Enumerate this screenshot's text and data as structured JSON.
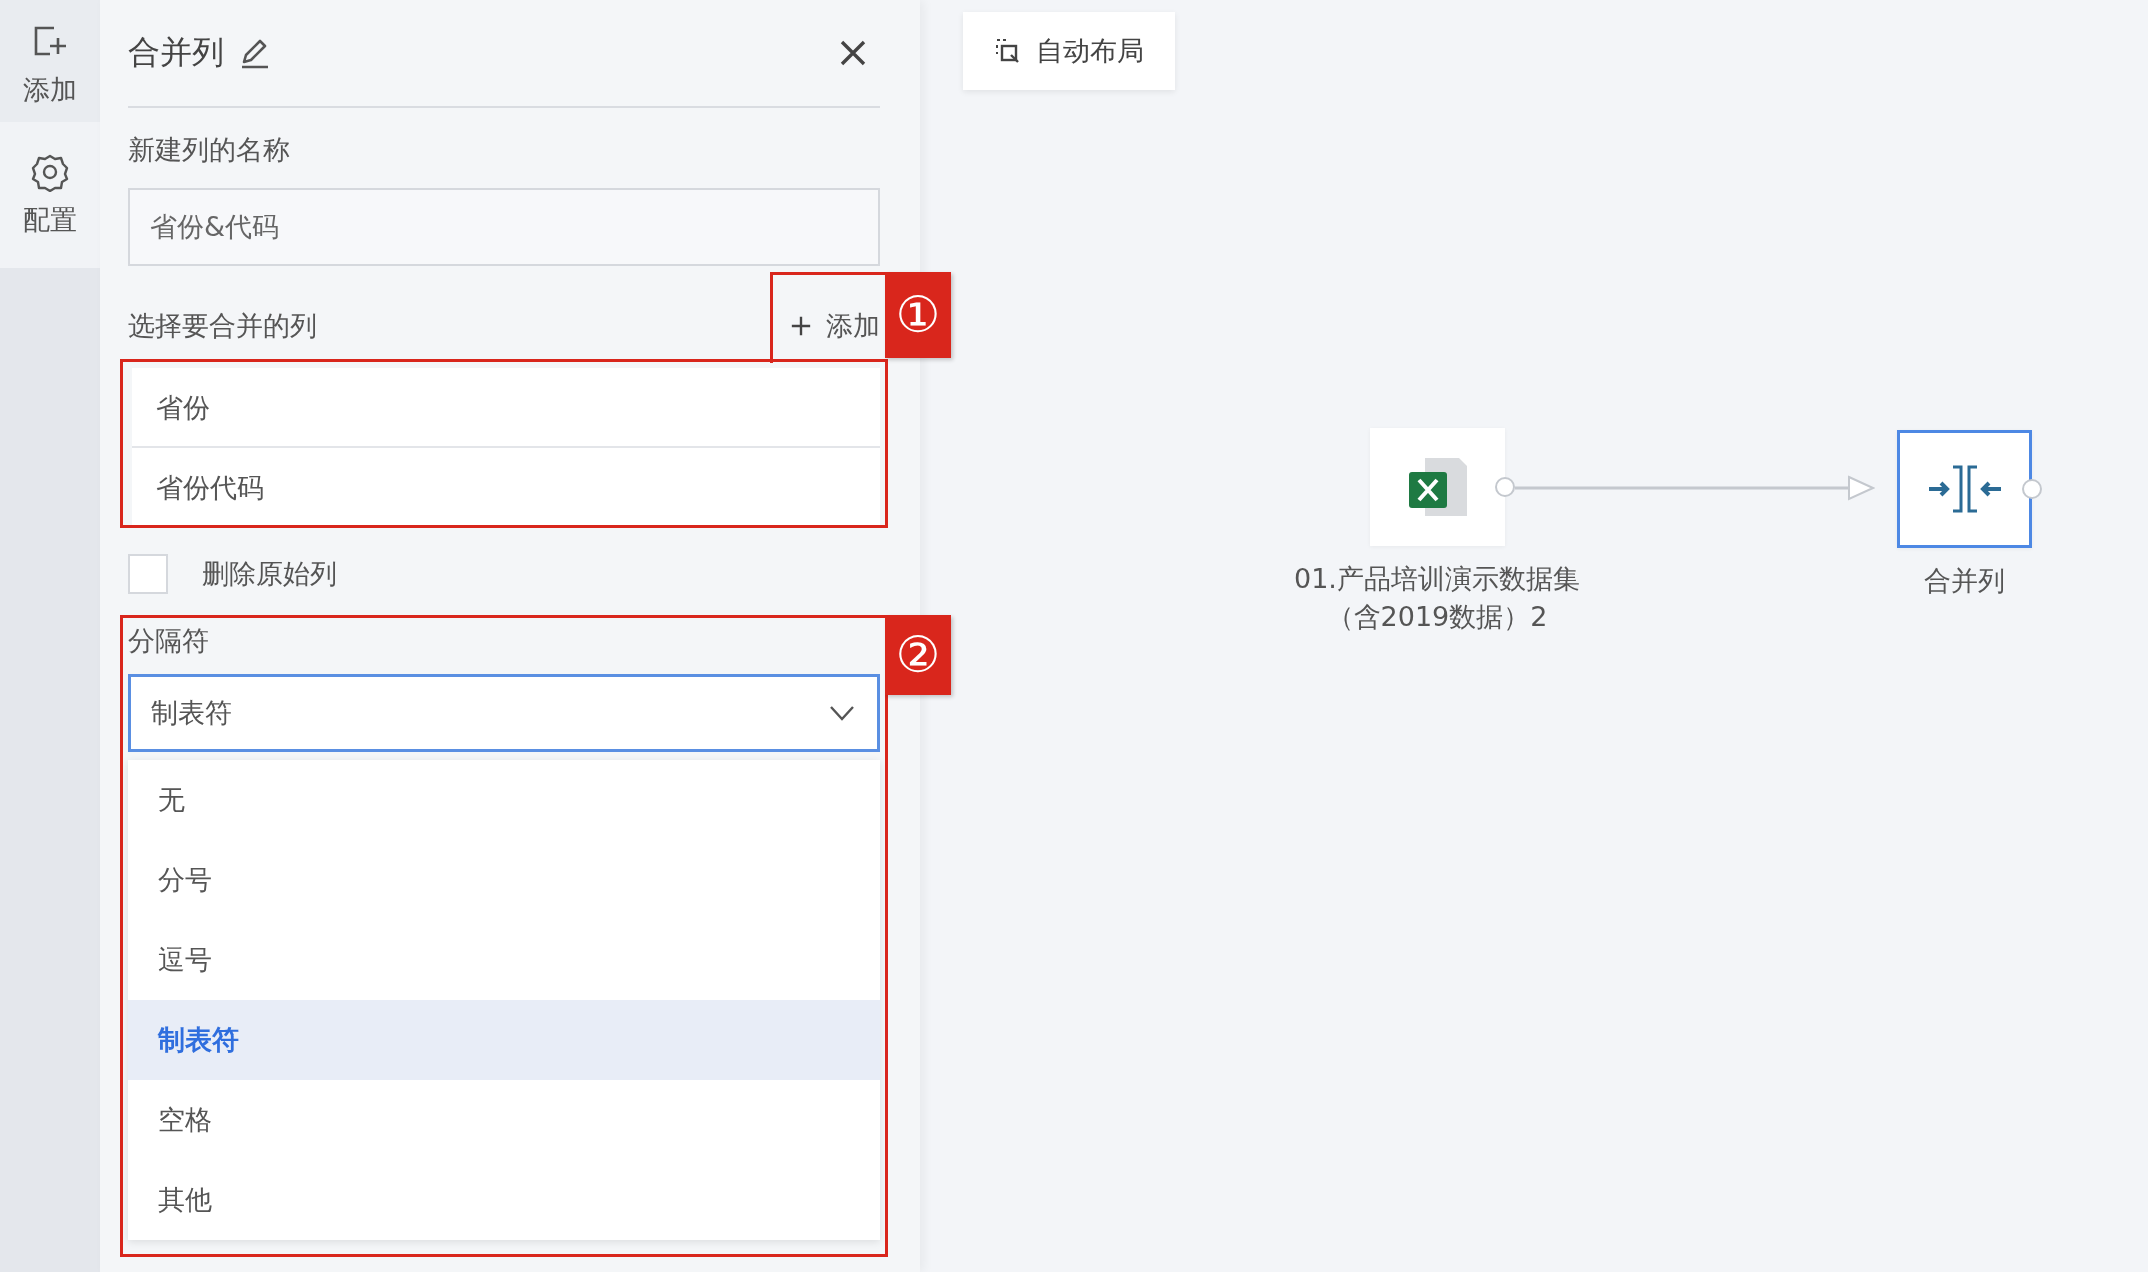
{
  "sidebar": {
    "items": [
      {
        "kind": "add",
        "label": "添加",
        "selected": false
      },
      {
        "kind": "settings",
        "label": "配置",
        "selected": true
      }
    ]
  },
  "panel": {
    "title": "合并列",
    "name_label": "新建列的名称",
    "name_value": "省份&代码",
    "columns_label": "选择要合并的列",
    "add_button": "添加",
    "columns": [
      "省份",
      "省份代码"
    ],
    "delete_original": {
      "label": "删除原始列",
      "checked": false
    },
    "separator": {
      "label": "分隔符",
      "value": "制表符",
      "expanded": true,
      "options": [
        {
          "label": "无",
          "selected": false
        },
        {
          "label": "分号",
          "selected": false
        },
        {
          "label": "逗号",
          "selected": false
        },
        {
          "label": "制表符",
          "selected": true
        },
        {
          "label": "空格",
          "selected": false
        },
        {
          "label": "其他",
          "selected": false
        }
      ]
    }
  },
  "annotations": [
    {
      "number": "①"
    },
    {
      "number": "②"
    }
  ],
  "canvas": {
    "auto_layout_button": "自动布局",
    "nodes": [
      {
        "kind": "excel",
        "label": "01.产品培训演示数据集（含2019数据）2",
        "selected": false
      },
      {
        "kind": "merge",
        "label": "合并列",
        "selected": true
      }
    ]
  }
}
